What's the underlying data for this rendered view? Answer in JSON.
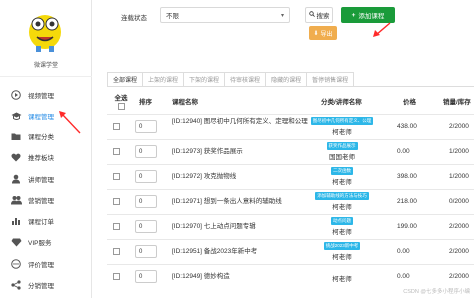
{
  "sidebar": {
    "brand": "微课学堂",
    "items": [
      {
        "label": "视频管理",
        "icon": "play-icon"
      },
      {
        "label": "课程管理",
        "icon": "graduation-cap-icon",
        "active": true
      },
      {
        "label": "课程分类",
        "icon": "folder-icon"
      },
      {
        "label": "推荐板块",
        "icon": "heart-icon"
      },
      {
        "label": "讲师管理",
        "icon": "person-icon"
      },
      {
        "label": "营销管理",
        "icon": "person-group-icon"
      },
      {
        "label": "课程订单",
        "icon": "bar-chart-icon"
      },
      {
        "label": "VIP服务",
        "icon": "diamond-icon"
      },
      {
        "label": "评价管理",
        "icon": "message-icon"
      },
      {
        "label": "分销管理",
        "icon": "share-icon"
      }
    ]
  },
  "toolbar": {
    "filter_label": "连载状态",
    "select_value": "不限",
    "search_label": "搜索",
    "add_label": "添加课程",
    "export_label": "导出"
  },
  "tabs": [
    "全部课程",
    "上架的课程",
    "下架的课程",
    "待审核课程",
    "隐藏的课程",
    "暂停销售课程"
  ],
  "table": {
    "headers": {
      "select_all": "全选",
      "sort": "排序",
      "name": "课程名称",
      "category_teacher": "分类/讲师名称",
      "price": "价格",
      "sales_stock": "销量/库存"
    },
    "rows": [
      {
        "sort": "0",
        "name": "[ID:12940] 图尽初中几何所有定义、定理和公理",
        "category": "图尽初中几何所有定义、公理",
        "teacher": "柯老师",
        "price": "438.00",
        "stock": "2/2000"
      },
      {
        "sort": "0",
        "name": "[ID:12973] 获奖作品展示",
        "category": "获奖作品展示",
        "teacher": "国国老师",
        "price": "0.00",
        "stock": "1/2000"
      },
      {
        "sort": "0",
        "name": "[ID:12972] 攻克抛物线",
        "category": "二次函数",
        "teacher": "柯老师",
        "price": "398.00",
        "stock": "1/2000"
      },
      {
        "sort": "0",
        "name": "[ID:12971] 想到一条出人意料的辅助线",
        "category": "添加辅助线的方法与技巧",
        "teacher": "柯老师",
        "price": "218.00",
        "stock": "0/2000"
      },
      {
        "sort": "0",
        "name": "[ID:12970] 七上动点问题专辑",
        "category": "动点问题",
        "teacher": "柯老师",
        "price": "199.00",
        "stock": "2/2000"
      },
      {
        "sort": "0",
        "name": "[ID:12951] 备战2023年新中考",
        "category": "挑战2023新中考",
        "teacher": "柯老师",
        "price": "0.00",
        "stock": "2/2000"
      },
      {
        "sort": "0",
        "name": "[ID:12949] 德妙构造",
        "category": "",
        "teacher": "柯老师",
        "price": "0.00",
        "stock": "2/2000"
      }
    ]
  },
  "watermark": "CSDN @七多多小程序小编",
  "colors": {
    "accent": "#1e88e5",
    "add_button": "#1a9b3a",
    "export_button": "#f0ad4e",
    "badge": "#2db7e8",
    "arrow": "#ff2a2a"
  }
}
